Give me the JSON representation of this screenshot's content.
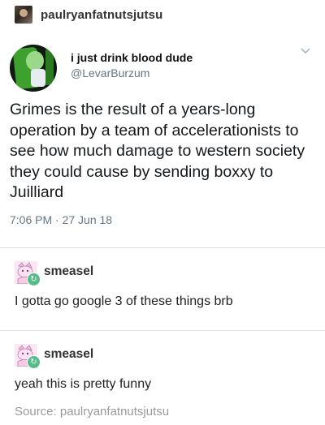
{
  "op": {
    "username": "paulryanfatnutsjutsu"
  },
  "tweet": {
    "display_name": "i just drink blood dude",
    "handle": "@LevarBurzum",
    "text": "Grimes is the result of a years-long operation by a team of accelerationists to see how much damage to western society they could cause by sending boxxy to Juilliard",
    "timestamp": "7:06 PM · 27 Jun 18"
  },
  "reblogs": [
    {
      "username": "smeasel",
      "body": "I gotta go google 3 of these things brb"
    },
    {
      "username": "smeasel",
      "body": "yeah this is pretty funny"
    }
  ],
  "source": {
    "label": "Source: paulryanfatnutsjutsu"
  },
  "colors": {
    "reblog_badge": "#56bc8a",
    "twitter_secondary": "#657786"
  }
}
